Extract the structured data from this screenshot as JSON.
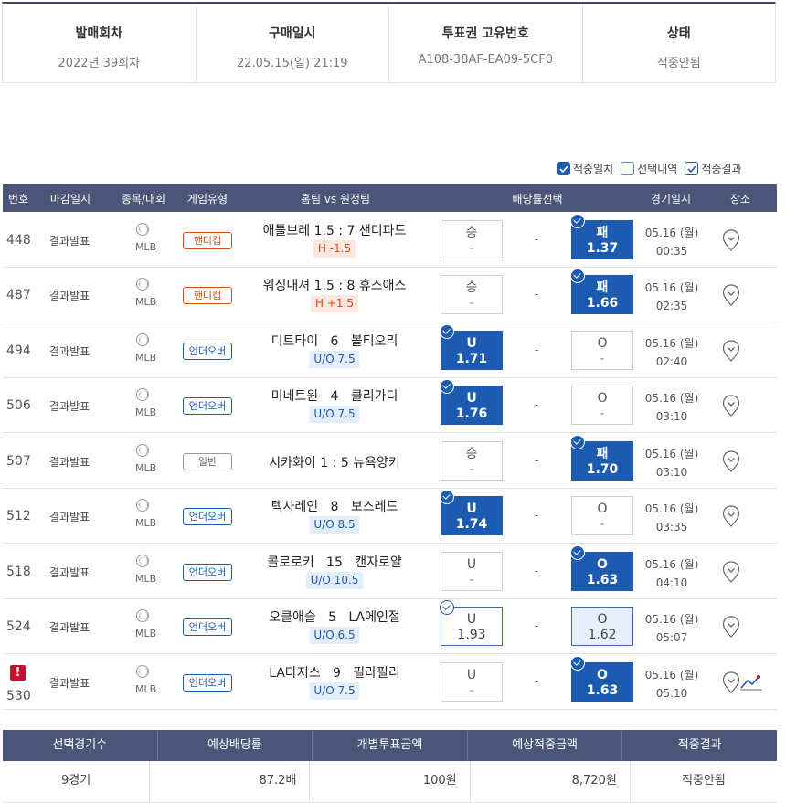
{
  "summary_top": [
    {
      "header": "발매회차",
      "value": "2022년 39회차"
    },
    {
      "header": "구매일시",
      "value": "22.05.15(일) 21:19"
    },
    {
      "header": "투표권 고유번호",
      "value": "A108-38AF-EA09-5CF0"
    },
    {
      "header": "상태",
      "value": "적중안됨"
    }
  ],
  "legend": {
    "hit_match": "적중일치",
    "selection": "선택내역",
    "hit_result": "적중결과"
  },
  "table_headers": {
    "num": "번호",
    "close": "마감일시",
    "sport": "종목/대회",
    "type": "게임유형",
    "teams": "홈팀 vs 원정팀",
    "odds": "배당률선택",
    "game_time": "경기일시",
    "venue": "장소"
  },
  "rows": [
    {
      "num": "448",
      "close": "결과발표",
      "league": "MLB",
      "type": "핸디캡",
      "home": "애틀브레",
      "hscore": "1.5",
      "sep": ":",
      "ascore": "7",
      "away": "샌디파드",
      "sub": "H -1.5",
      "left": {
        "top": "승",
        "bottom": "-"
      },
      "mid": "-",
      "right": {
        "top": "패",
        "bottom": "1.37"
      },
      "date": "05.16 (월)",
      "time": "00:35"
    },
    {
      "num": "487",
      "close": "결과발표",
      "league": "MLB",
      "type": "핸디캡",
      "home": "워싱내셔",
      "hscore": "1.5",
      "sep": ":",
      "ascore": "8",
      "away": "휴스애스",
      "sub": "H +1.5",
      "left": {
        "top": "승",
        "bottom": "-"
      },
      "mid": "-",
      "right": {
        "top": "패",
        "bottom": "1.66"
      },
      "date": "05.16 (월)",
      "time": "02:35"
    },
    {
      "num": "494",
      "close": "결과발표",
      "league": "MLB",
      "type": "언더오버",
      "home": "디트타이",
      "hscore": "6",
      "sep": "",
      "ascore": "",
      "away": "볼티오리",
      "sub": "U/O 7.5",
      "left": {
        "top": "U",
        "bottom": "1.71"
      },
      "mid": "-",
      "right": {
        "top": "O",
        "bottom": "-"
      },
      "date": "05.16 (월)",
      "time": "02:40"
    },
    {
      "num": "506",
      "close": "결과발표",
      "league": "MLB",
      "type": "언더오버",
      "home": "미네트윈",
      "hscore": "4",
      "sep": "",
      "ascore": "",
      "away": "클리가디",
      "sub": "U/O 7.5",
      "left": {
        "top": "U",
        "bottom": "1.76"
      },
      "mid": "-",
      "right": {
        "top": "O",
        "bottom": "-"
      },
      "date": "05.16 (월)",
      "time": "03:10"
    },
    {
      "num": "507",
      "close": "결과발표",
      "league": "MLB",
      "type": "일반",
      "home": "시카화이",
      "hscore": "1",
      "sep": ":",
      "ascore": "5",
      "away": "뉴욕양키",
      "sub": "",
      "left": {
        "top": "승",
        "bottom": "-"
      },
      "mid": "-",
      "right": {
        "top": "패",
        "bottom": "1.70"
      },
      "date": "05.16 (월)",
      "time": "03:10"
    },
    {
      "num": "512",
      "close": "결과발표",
      "league": "MLB",
      "type": "언더오버",
      "home": "텍사레인",
      "hscore": "8",
      "sep": "",
      "ascore": "",
      "away": "보스레드",
      "sub": "U/O 8.5",
      "left": {
        "top": "U",
        "bottom": "1.74"
      },
      "mid": "-",
      "right": {
        "top": "O",
        "bottom": "-"
      },
      "date": "05.16 (월)",
      "time": "03:35"
    },
    {
      "num": "518",
      "close": "결과발표",
      "league": "MLB",
      "type": "언더오버",
      "home": "콜로로키",
      "hscore": "15",
      "sep": "",
      "ascore": "",
      "away": "캔자로얄",
      "sub": "U/O 10.5",
      "left": {
        "top": "U",
        "bottom": "-"
      },
      "mid": "-",
      "right": {
        "top": "O",
        "bottom": "1.63"
      },
      "date": "05.16 (월)",
      "time": "04:10"
    },
    {
      "num": "524",
      "close": "결과발표",
      "league": "MLB",
      "type": "언더오버",
      "home": "오클애슬",
      "hscore": "5",
      "sep": "",
      "ascore": "",
      "away": "LA에인절",
      "sub": "U/O 6.5",
      "left": {
        "top": "U",
        "bottom": "1.93"
      },
      "mid": "-",
      "right": {
        "top": "O",
        "bottom": "1.62"
      },
      "date": "05.16 (월)",
      "time": "05:07"
    },
    {
      "num": "530",
      "close": "결과발표",
      "league": "MLB",
      "type": "언더오버",
      "home": "LA다저스",
      "hscore": "9",
      "sep": "",
      "ascore": "",
      "away": "필라필리",
      "sub": "U/O 7.5",
      "left": {
        "top": "U",
        "bottom": "-"
      },
      "mid": "-",
      "right": {
        "top": "O",
        "bottom": "1.63"
      },
      "date": "05.16 (월)",
      "time": "05:10",
      "alert": "!"
    }
  ],
  "summary_bottom": {
    "headers": [
      "선택경기수",
      "예상배당률",
      "개별투표금액",
      "예상적중금액",
      "적중결과"
    ],
    "values": [
      "9경기",
      "87.2배",
      "100원",
      "8,720원",
      "적중안됨"
    ]
  }
}
